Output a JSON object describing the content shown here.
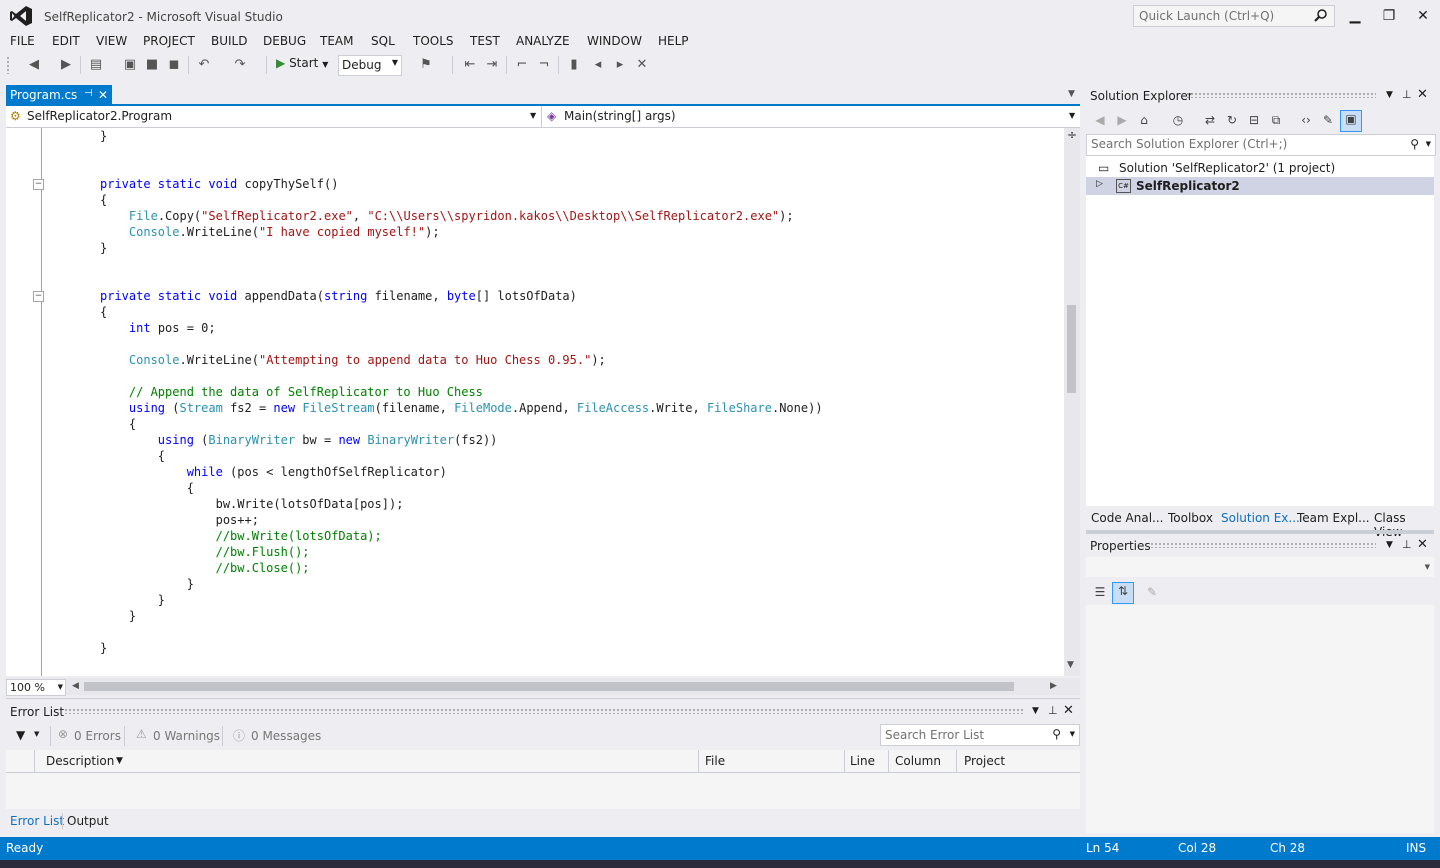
{
  "window": {
    "title": "SelfReplicator2 - Microsoft Visual Studio",
    "quick_launch_placeholder": "Quick Launch (Ctrl+Q)",
    "minimize": "▁",
    "restore": "❐",
    "close": "✕"
  },
  "menu": [
    "FILE",
    "EDIT",
    "VIEW",
    "PROJECT",
    "BUILD",
    "DEBUG",
    "TEAM",
    "SQL",
    "TOOLS",
    "TEST",
    "ANALYZE",
    "WINDOW",
    "HELP"
  ],
  "toolbar": {
    "start_label": "Start",
    "config_value": "Debug"
  },
  "editor": {
    "tab_label": "Program.cs",
    "nav_left": "SelfReplicator2.Program",
    "nav_right": "Main(string[] args)",
    "zoom": "100 %",
    "lines": [
      [
        {
          "t": "}",
          "c": "plain"
        }
      ],
      [],
      [
        {
          "t": "private static void ",
          "c": "kw"
        },
        {
          "t": "copyThySelf()",
          "c": "plain"
        }
      ],
      [
        {
          "t": "{",
          "c": "plain"
        }
      ],
      [
        {
          "t": "    ",
          "c": "plain"
        },
        {
          "t": "File",
          "c": "type"
        },
        {
          "t": ".Copy(",
          "c": "plain"
        },
        {
          "t": "\"SelfReplicator2.exe\"",
          "c": "str"
        },
        {
          "t": ", ",
          "c": "plain"
        },
        {
          "t": "\"C:\\\\Users\\\\spyridon.kakos\\\\Desktop\\\\SelfReplicator2.exe\"",
          "c": "str"
        },
        {
          "t": ");",
          "c": "plain"
        }
      ],
      [
        {
          "t": "    ",
          "c": "plain"
        },
        {
          "t": "Console",
          "c": "type"
        },
        {
          "t": ".WriteLine(",
          "c": "plain"
        },
        {
          "t": "\"I have copied myself!\"",
          "c": "str"
        },
        {
          "t": ");",
          "c": "plain"
        }
      ],
      [
        {
          "t": "}",
          "c": "plain"
        }
      ],
      [],
      [],
      [
        {
          "t": "private static void ",
          "c": "kw"
        },
        {
          "t": "appendData(",
          "c": "plain"
        },
        {
          "t": "string",
          "c": "kw"
        },
        {
          "t": " filename, ",
          "c": "plain"
        },
        {
          "t": "byte",
          "c": "kw"
        },
        {
          "t": "[] lotsOfData)",
          "c": "plain"
        }
      ],
      [
        {
          "t": "{",
          "c": "plain"
        }
      ],
      [
        {
          "t": "    ",
          "c": "plain"
        },
        {
          "t": "int",
          "c": "kw"
        },
        {
          "t": " pos = 0;",
          "c": "plain"
        }
      ],
      [],
      [
        {
          "t": "    ",
          "c": "plain"
        },
        {
          "t": "Console",
          "c": "type"
        },
        {
          "t": ".WriteLine(",
          "c": "plain"
        },
        {
          "t": "\"Attempting to append data to Huo Chess 0.95.\"",
          "c": "str"
        },
        {
          "t": ");",
          "c": "plain"
        }
      ],
      [],
      [
        {
          "t": "    // Append the data of SelfReplicator to Huo Chess",
          "c": "cm"
        }
      ],
      [
        {
          "t": "    ",
          "c": "plain"
        },
        {
          "t": "using",
          "c": "kw"
        },
        {
          "t": " (",
          "c": "plain"
        },
        {
          "t": "Stream",
          "c": "type"
        },
        {
          "t": " fs2 = ",
          "c": "plain"
        },
        {
          "t": "new",
          "c": "kw"
        },
        {
          "t": " ",
          "c": "plain"
        },
        {
          "t": "FileStream",
          "c": "type"
        },
        {
          "t": "(filename, ",
          "c": "plain"
        },
        {
          "t": "FileMode",
          "c": "type"
        },
        {
          "t": ".Append, ",
          "c": "plain"
        },
        {
          "t": "FileAccess",
          "c": "type"
        },
        {
          "t": ".Write, ",
          "c": "plain"
        },
        {
          "t": "FileShare",
          "c": "type"
        },
        {
          "t": ".None))",
          "c": "plain"
        }
      ],
      [
        {
          "t": "    {",
          "c": "plain"
        }
      ],
      [
        {
          "t": "        ",
          "c": "plain"
        },
        {
          "t": "using",
          "c": "kw"
        },
        {
          "t": " (",
          "c": "plain"
        },
        {
          "t": "BinaryWriter",
          "c": "type"
        },
        {
          "t": " bw = ",
          "c": "plain"
        },
        {
          "t": "new",
          "c": "kw"
        },
        {
          "t": " ",
          "c": "plain"
        },
        {
          "t": "BinaryWriter",
          "c": "type"
        },
        {
          "t": "(fs2))",
          "c": "plain"
        }
      ],
      [
        {
          "t": "        {",
          "c": "plain"
        }
      ],
      [
        {
          "t": "            ",
          "c": "plain"
        },
        {
          "t": "while",
          "c": "kw"
        },
        {
          "t": " (pos < lengthOfSelfReplicator)",
          "c": "plain"
        }
      ],
      [
        {
          "t": "            {",
          "c": "plain"
        }
      ],
      [
        {
          "t": "                bw.Write(lotsOfData[pos]);",
          "c": "plain"
        }
      ],
      [
        {
          "t": "                pos++;",
          "c": "plain"
        }
      ],
      [
        {
          "t": "                //bw.Write(lotsOfData);",
          "c": "cm"
        }
      ],
      [
        {
          "t": "                //bw.Flush();",
          "c": "cm"
        }
      ],
      [
        {
          "t": "                //bw.Close();",
          "c": "cm"
        }
      ],
      [
        {
          "t": "            }",
          "c": "plain"
        }
      ],
      [
        {
          "t": "        }",
          "c": "plain"
        }
      ],
      [
        {
          "t": "    }",
          "c": "plain"
        }
      ],
      [],
      [
        {
          "t": "}",
          "c": "plain"
        }
      ]
    ]
  },
  "error_list": {
    "title": "Error List",
    "errors": "0 Errors",
    "warnings": "0 Warnings",
    "messages": "0 Messages",
    "search_placeholder": "Search Error List",
    "columns": [
      "Description",
      "File",
      "Line",
      "Column",
      "Project"
    ],
    "tabs": [
      "Error List",
      "Output"
    ]
  },
  "solution_explorer": {
    "title": "Solution Explorer",
    "search_placeholder": "Search Solution Explorer (Ctrl+;)",
    "solution_label": "Solution 'SelfReplicator2' (1 project)",
    "project_label": "SelfReplicator2",
    "tabs": [
      "Code Anal...",
      "Toolbox",
      "Solution Ex...",
      "Team Expl...",
      "Class View"
    ]
  },
  "properties": {
    "title": "Properties"
  },
  "status": {
    "ready": "Ready",
    "ln": "Ln 54",
    "col": "Col 28",
    "ch": "Ch 28",
    "mode": "INS"
  },
  "colors": {
    "accent": "#007acc",
    "keyword": "#0000ff",
    "string": "#a31515",
    "type": "#2b91af",
    "comment": "#008000"
  }
}
